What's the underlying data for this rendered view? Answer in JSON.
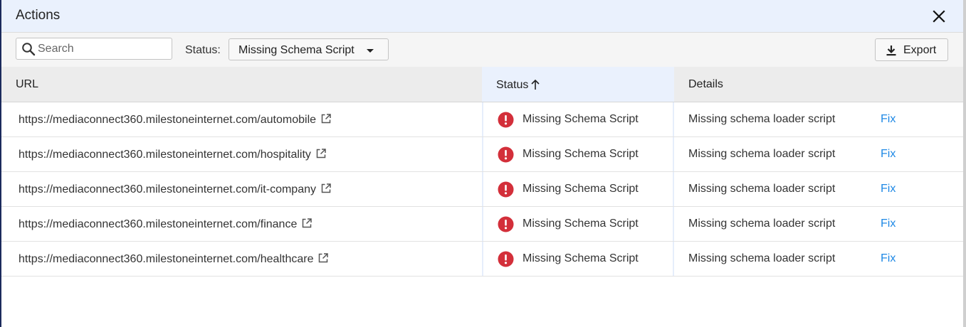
{
  "dialog": {
    "title": "Actions"
  },
  "toolbar": {
    "search_placeholder": "Search",
    "status_label": "Status:",
    "status_selected": "Missing Schema Script",
    "export_label": "Export"
  },
  "table": {
    "columns": {
      "url": "URL",
      "status": "Status",
      "details": "Details"
    },
    "rows": [
      {
        "url": "https://mediaconnect360.milestoneinternet.com/automobile",
        "status": "Missing Schema Script",
        "details": "Missing schema loader script",
        "action": "Fix"
      },
      {
        "url": "https://mediaconnect360.milestoneinternet.com/hospitality",
        "status": "Missing Schema Script",
        "details": "Missing schema loader script",
        "action": "Fix"
      },
      {
        "url": "https://mediaconnect360.milestoneinternet.com/it-company",
        "status": "Missing Schema Script",
        "details": "Missing schema loader script",
        "action": "Fix"
      },
      {
        "url": "https://mediaconnect360.milestoneinternet.com/finance",
        "status": "Missing Schema Script",
        "details": "Missing schema loader script",
        "action": "Fix"
      },
      {
        "url": "https://mediaconnect360.milestoneinternet.com/healthcare",
        "status": "Missing Schema Script",
        "details": "Missing schema loader script",
        "action": "Fix"
      }
    ]
  },
  "colors": {
    "title_bar": "#eaf1fd",
    "error_red": "#d32f3a",
    "link_blue": "#1e88e5"
  },
  "icons": {
    "close": "close-icon",
    "search": "search-icon",
    "dropdown": "caret-down-icon",
    "export": "download-icon",
    "sort": "arrow-up-icon",
    "external_link": "external-link-icon",
    "error": "error-icon"
  }
}
